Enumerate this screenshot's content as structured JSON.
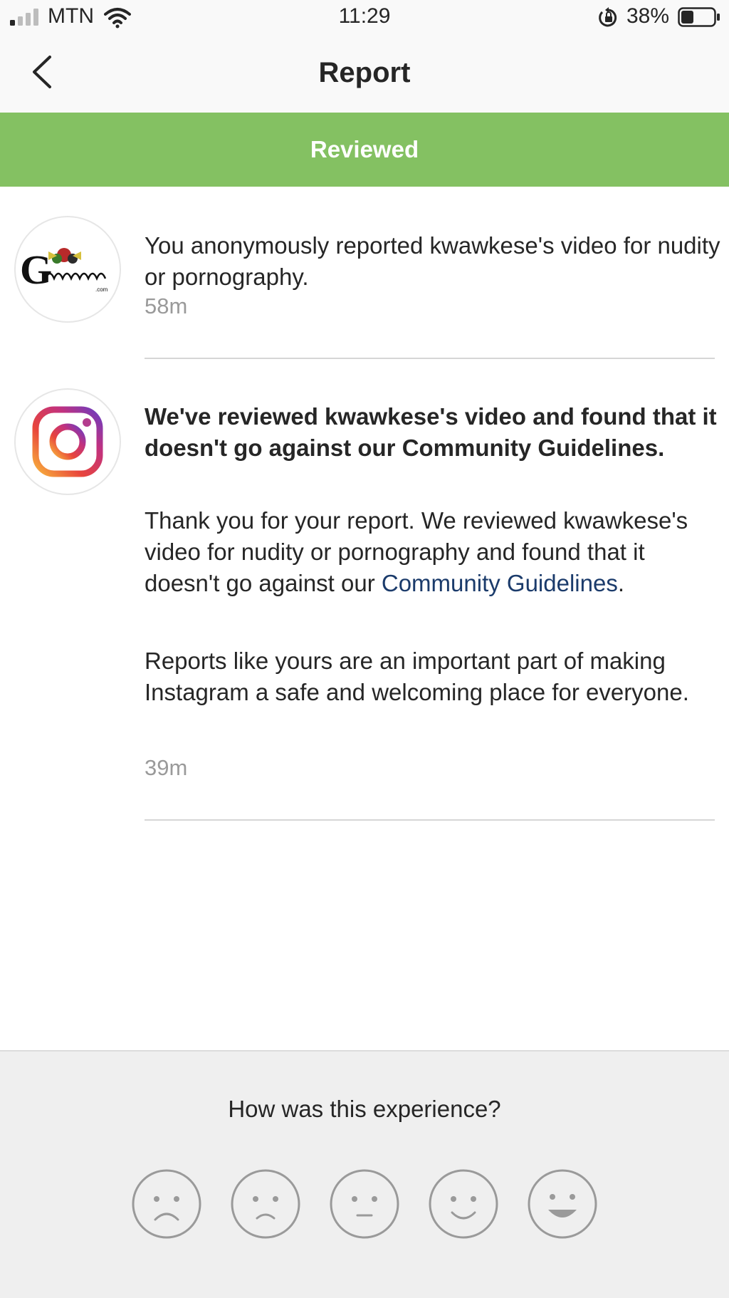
{
  "status_bar": {
    "carrier": "MTN",
    "time": "11:29",
    "battery": "38%",
    "icons": [
      "signal-icon",
      "wifi-icon",
      "orientation-lock-icon",
      "battery-icon"
    ]
  },
  "header": {
    "title": "Report",
    "back_icon": "back-chevron-icon"
  },
  "banner": {
    "label": "Reviewed",
    "color": "#84c162"
  },
  "items": [
    {
      "avatar": "guawafuo-logo",
      "text": "You anonymously reported kwawkese's video for nudity or pornography.",
      "time": "58m"
    },
    {
      "avatar": "instagram-logo",
      "title": "We've reviewed kwawkese's video and found that it doesn't go against our Community Guidelines.",
      "body_line1": "Thank you for your report. We reviewed kwawkese's video for nudity or pornography and found that it doesn't go against our ",
      "body_link": "Community Guidelines",
      "body_end": ".",
      "body2": "Reports like yours are an important part of making Instagram a safe and welcoming place for everyone.",
      "time": "39m"
    }
  ],
  "footer": {
    "question": "How was this experience?",
    "faces": [
      "very-sad-face-icon",
      "sad-face-icon",
      "neutral-face-icon",
      "smile-face-icon",
      "happy-face-icon"
    ]
  },
  "colors": {
    "link": "#1b3b6b",
    "timestamp": "#9a9a9a"
  }
}
